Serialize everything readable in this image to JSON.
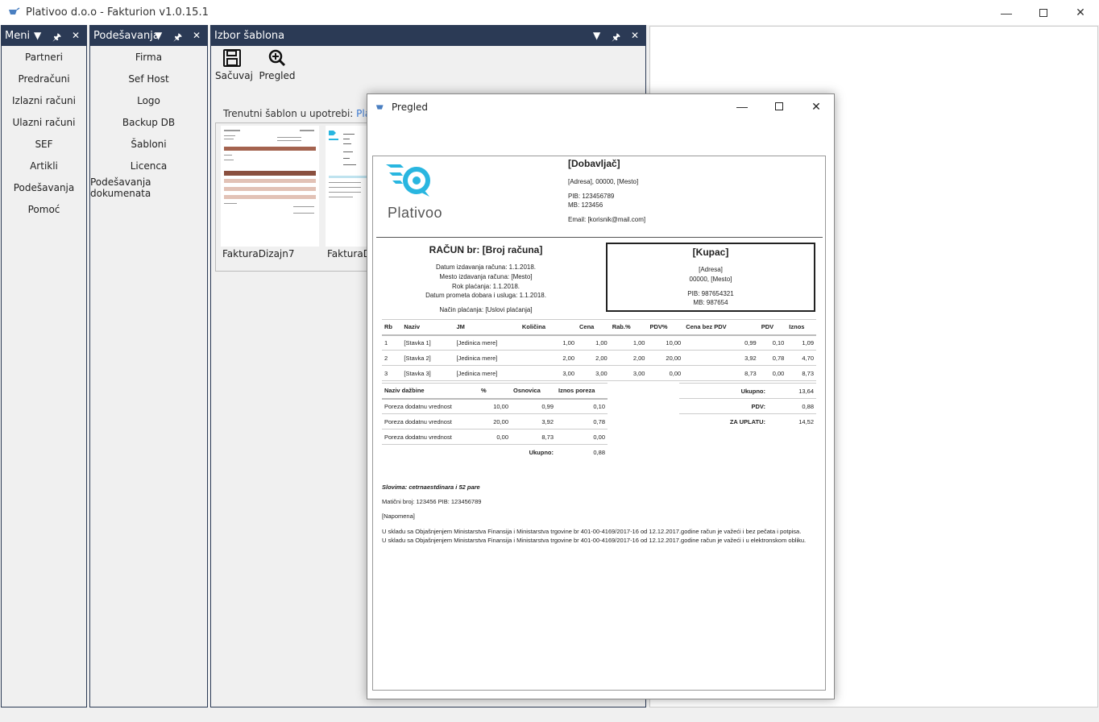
{
  "window": {
    "title": "Plativoo d.o.o - Fakturion v1.0.15.1"
  },
  "panes": {
    "meni": {
      "title": "Meni",
      "items": [
        "Partneri",
        "Predračuni",
        "Izlazni računi",
        "Ulazni računi",
        "SEF",
        "Artikli",
        "Podešavanja",
        "Pomoć"
      ]
    },
    "podesavanja": {
      "title": "Podešavanja",
      "items": [
        "Firma",
        "Sef Host",
        "Logo",
        "Backup DB",
        "Šabloni",
        "Licenca",
        "Podešavanja dokumenata"
      ]
    },
    "izbor": {
      "title": "Izbor šablona",
      "save_label": "Sačuvaj",
      "preview_label": "Pregled",
      "current_label": "Trenutni šablon u upotrebi:",
      "current_value": "Plativ",
      "templates": [
        "FakturaDizajn7",
        "FakturaDi"
      ]
    }
  },
  "dialog": {
    "title": "Pregled",
    "supplier": {
      "name": "[Dobavljač]",
      "address": "[Adresa], 00000, [Mesto]",
      "pib": "PIB: 123456789",
      "mb": "MB: 123456",
      "email": "Email: [korisnik@mail.com]"
    },
    "logo_text": "Plativoo",
    "invoice": {
      "title": "RAČUN br: [Broj računa]",
      "lines": [
        "Datum izdavanja računa: 1.1.2018.",
        "Mesto izdavanja računa: [Mesto]",
        "Rok plaćanja: 1.1.2018.",
        "Datum prometa dobara i usluga: 1.1.2018."
      ],
      "payment": "Način plaćanja: [Uslovi plaćanja]"
    },
    "buyer": {
      "name": "[Kupac]",
      "address": "[Adresa]",
      "city": "00000, [Mesto]",
      "pib": "PIB: 987654321",
      "mb": "MB: 987654"
    },
    "items_headers": [
      "Rb",
      "Naziv",
      "JM",
      "Količina",
      "Cena",
      "Rab.%",
      "PDV%",
      "Cena bez PDV",
      "PDV",
      "Iznos"
    ],
    "items": [
      [
        "1",
        "[Stavka 1]",
        "[Jedinica mere]",
        "1,00",
        "1,00",
        "1,00",
        "10,00",
        "0,99",
        "0,10",
        "1,09"
      ],
      [
        "2",
        "[Stavka 2]",
        "[Jedinica mere]",
        "2,00",
        "2,00",
        "2,00",
        "20,00",
        "3,92",
        "0,78",
        "4,70"
      ],
      [
        "3",
        "[Stavka 3]",
        "[Jedinica mere]",
        "3,00",
        "3,00",
        "3,00",
        "0,00",
        "8,73",
        "0,00",
        "8,73"
      ]
    ],
    "tax_headers": [
      "Naziv dažbine",
      "%",
      "Osnovica",
      "Iznos poreza"
    ],
    "tax_rows": [
      [
        "Poreza dodatnu vrednost",
        "10,00",
        "0,99",
        "0,10"
      ],
      [
        "Poreza dodatnu vrednost",
        "20,00",
        "3,92",
        "0,78"
      ],
      [
        "Poreza dodatnu vrednost",
        "0,00",
        "8,73",
        "0,00"
      ]
    ],
    "tax_total_label": "Ukupno:",
    "tax_total": "0,88",
    "totals": [
      [
        "Ukupno:",
        "13,64"
      ],
      [
        "PDV:",
        "0,88"
      ],
      [
        "ZA UPLATU:",
        "14,52"
      ]
    ],
    "slovima": "Slovima: cetrnaestdinara i 52 pare",
    "maticni": "Matični broj: 123456 PIB: 123456789",
    "napomena": "[Napomena]",
    "legal1": "U skladu sa Objašnjenjem Ministarstva Finansija i Ministarstva trgovine br 401-00-4169/2017-16 od 12.12.2017.godine račun je važeći i bez pečata i potpisa.",
    "legal2": "U skladu sa Objašnjenjem Ministarstva Finansija i Ministarstva trgovine br 401-00-4169/2017-16 od 12.12.2017.godine račun je važeći i u elektronskom obliku."
  },
  "colors": {
    "pane_header": "#2b3a55",
    "accent_link": "#3b7bd4",
    "logo": "#29b6e0"
  }
}
